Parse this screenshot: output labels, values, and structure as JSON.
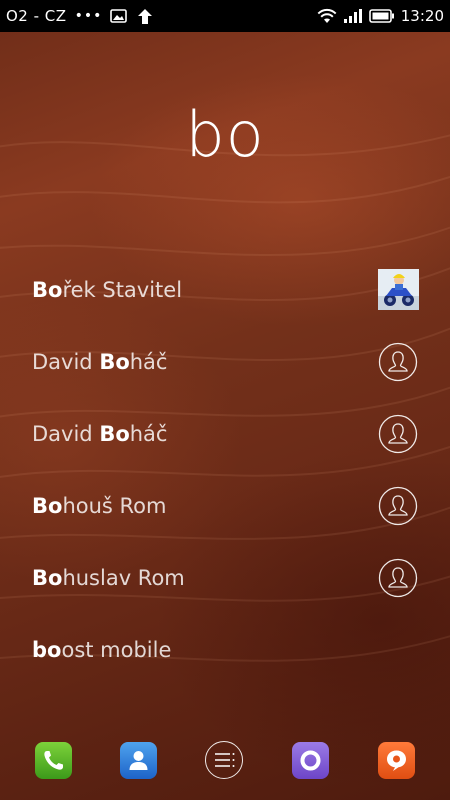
{
  "status_bar": {
    "carrier": "O2 - CZ",
    "dots": "•••",
    "time": "13:20"
  },
  "search": {
    "query": "bo"
  },
  "results": [
    {
      "match": "Bo",
      "rest": "řek Stavitel",
      "prefix": "",
      "avatar": "photo"
    },
    {
      "prefix": "David ",
      "match": "Bo",
      "rest": "háč",
      "avatar": "default"
    },
    {
      "prefix": "David ",
      "match": "Bo",
      "rest": "háč",
      "avatar": "default"
    },
    {
      "prefix": "",
      "match": "Bo",
      "rest": "houš Rom",
      "avatar": "default"
    },
    {
      "prefix": "",
      "match": "Bo",
      "rest": "huslav Rom",
      "avatar": "default"
    },
    {
      "prefix": "",
      "match": "bo",
      "rest": "ost mobile",
      "avatar": "none"
    }
  ],
  "dock": {
    "icons": [
      "phone-icon",
      "contacts-icon",
      "menu-icon",
      "circle-app-icon",
      "chat-icon"
    ]
  },
  "colors": {
    "phone": "#4caf27",
    "contacts": "#2a79d8",
    "circle_app": "#7b55d4",
    "chat": "#f0601e"
  }
}
